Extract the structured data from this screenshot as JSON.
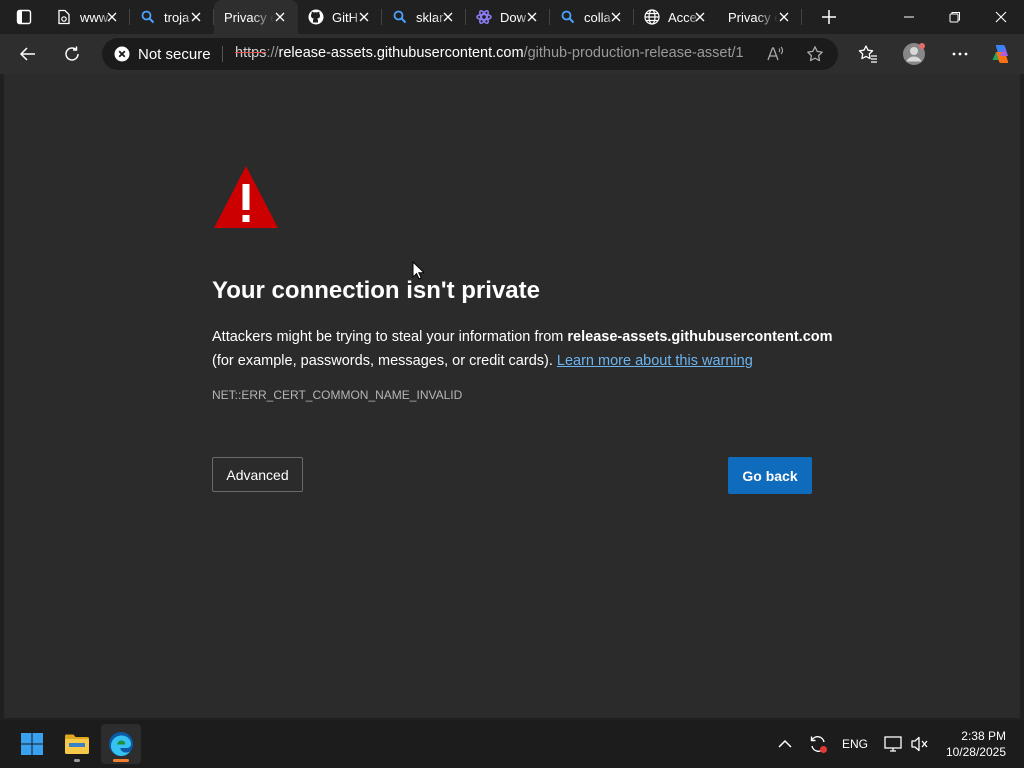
{
  "tabs": [
    {
      "title": "www.",
      "icon": "file-icon"
    },
    {
      "title": "troja",
      "icon": "search-icon"
    },
    {
      "title": "Privacy e",
      "icon": "",
      "active": true
    },
    {
      "title": "GitH",
      "icon": "github-icon"
    },
    {
      "title": "sklar",
      "icon": "search-icon"
    },
    {
      "title": "Dow",
      "icon": "edge-dev-icon"
    },
    {
      "title": "colla",
      "icon": "search-icon"
    },
    {
      "title": "Acce",
      "icon": "globe-icon"
    },
    {
      "title": "Privacy e",
      "icon": ""
    }
  ],
  "address_bar": {
    "security_label": "Not secure",
    "url_scheme": "https",
    "url_separator": "://",
    "url_host": "release-assets.githubusercontent.com",
    "url_path": "/github-production-release-asset/1..."
  },
  "page": {
    "heading": "Your connection isn't private",
    "desc_prefix": "Attackers might be trying to steal your information from ",
    "desc_host": "release-assets.githubusercontent.com",
    "desc_suffix": " (for example, passwords, messages, or credit cards). ",
    "learn_more": "Learn more about this warning",
    "error_code": "NET::ERR_CERT_COMMON_NAME_INVALID",
    "advanced_label": "Advanced",
    "go_back_label": "Go back"
  },
  "taskbar": {
    "language": "ENG",
    "time": "2:38 PM",
    "date": "10/28/2025"
  },
  "colors": {
    "warning_red": "#cc0000",
    "accent_blue": "#0f6cbd",
    "link_blue": "#6cb4f0"
  }
}
